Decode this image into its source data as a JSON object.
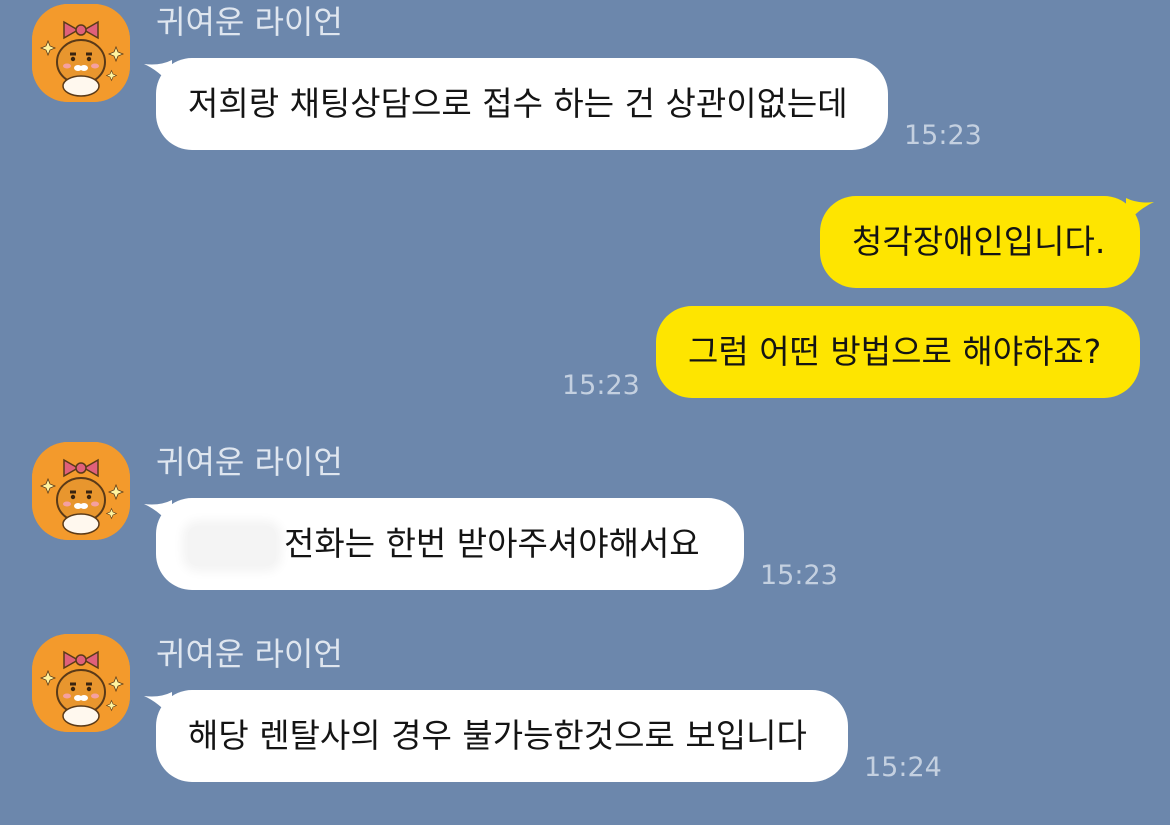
{
  "colors": {
    "background": "#6c87ac",
    "incoming_bubble": "#ffffff",
    "outgoing_bubble": "#fee500",
    "avatar": "#f39a2c",
    "timestamp": "#c4d0e0",
    "sender_name": "#dfe6ef"
  },
  "avatar_icon": "ryan-character-with-bow-icon",
  "messages": [
    {
      "direction": "incoming",
      "sender": "귀여운 라이언",
      "text": "저희랑 채팅상담으로 접수 하는 건 상관이없는데",
      "time": "15:23"
    },
    {
      "direction": "outgoing",
      "text": "청각장애인입니다.",
      "time": ""
    },
    {
      "direction": "outgoing",
      "text": "그럼 어떤 방법으로 해야하죠?",
      "time": "15:23"
    },
    {
      "direction": "incoming",
      "sender": "귀여운 라이언",
      "text": "전화는 한번 받아주셔야해서요",
      "redacted_prefix": true,
      "time": "15:23"
    },
    {
      "direction": "incoming",
      "sender": "귀여운 라이언",
      "text": "해당 렌탈사의 경우 불가능한것으로 보입니다",
      "time": "15:24"
    }
  ]
}
